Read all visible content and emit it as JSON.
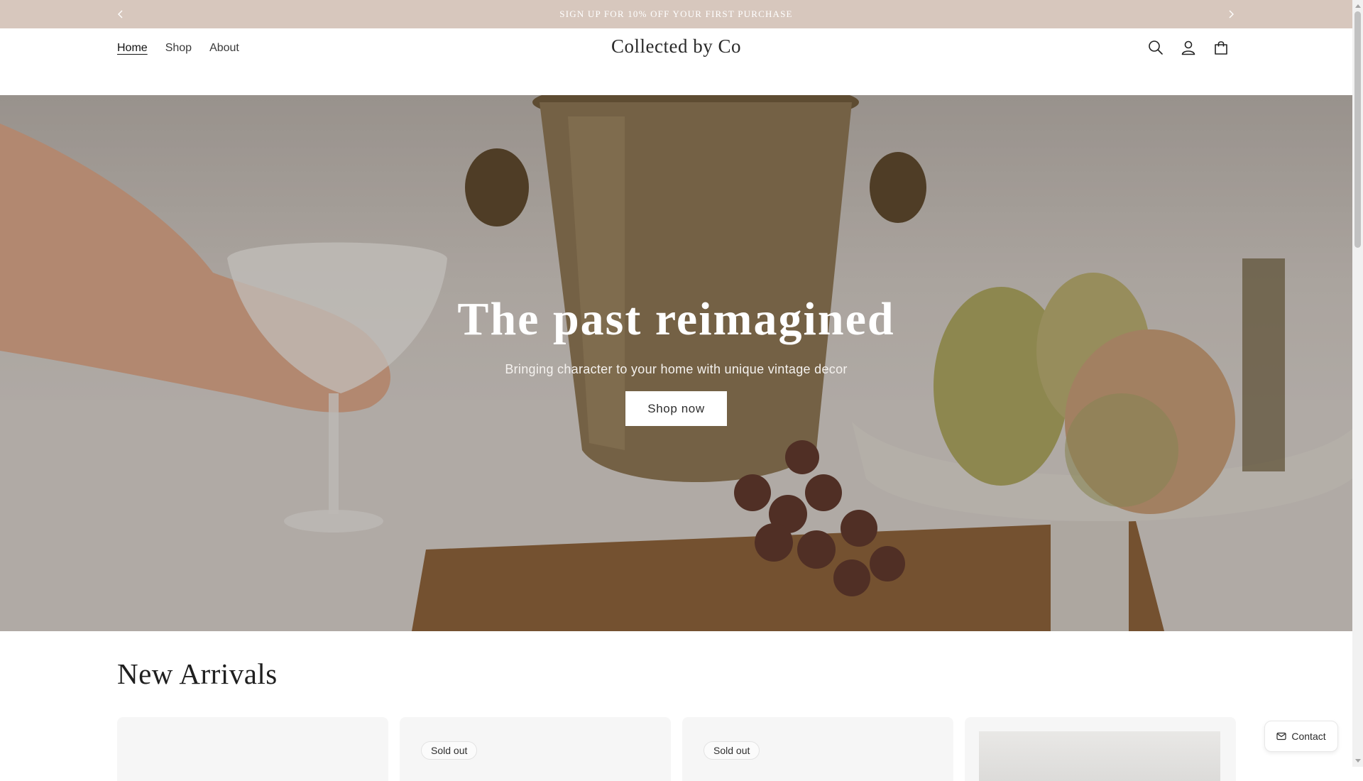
{
  "announcement": {
    "text": "SIGN UP FOR 10% OFF YOUR FIRST PURCHASE",
    "prev_icon": "chevron-left-icon",
    "next_icon": "chevron-right-icon"
  },
  "header": {
    "nav": [
      {
        "label": "Home",
        "active": true
      },
      {
        "label": "Shop",
        "active": false
      },
      {
        "label": "About",
        "active": false
      }
    ],
    "logo": "Collected by Co",
    "icons": [
      "search-icon",
      "account-icon",
      "cart-icon"
    ]
  },
  "hero": {
    "title": "The past reimagined",
    "subtitle": "Bringing character to your home with unique vintage decor",
    "button": "Shop now"
  },
  "arrivals": {
    "title": "New Arrivals",
    "cards": [
      {
        "badge": ""
      },
      {
        "badge": "Sold out"
      },
      {
        "badge": "Sold out"
      },
      {
        "badge": ""
      }
    ]
  },
  "contact": {
    "label": "Contact",
    "icon": "mail-icon"
  },
  "colors": {
    "announcement_bg": "#d7c7bd",
    "button_bg": "#ffffff",
    "text": "#1f1f1f"
  }
}
